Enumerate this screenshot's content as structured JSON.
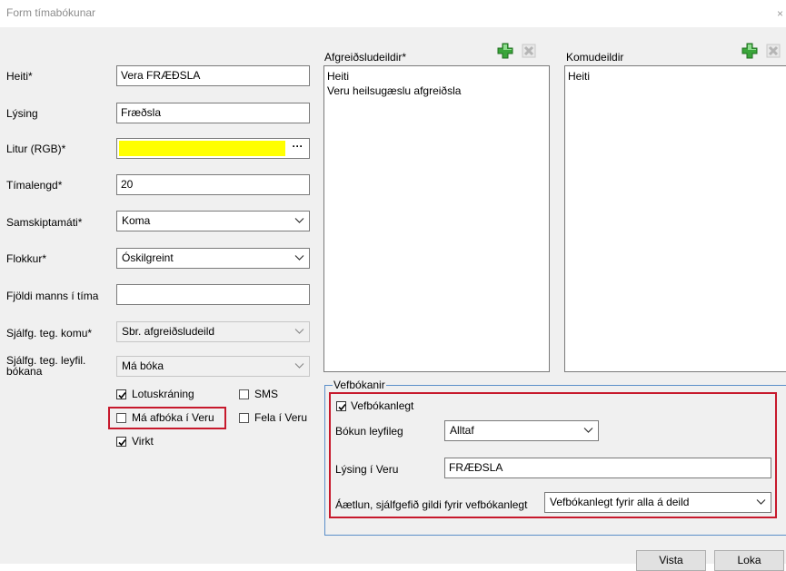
{
  "window": {
    "title": "Form tímabókunar",
    "close_glyph": "×"
  },
  "fields": {
    "heiti": {
      "label": "Heiti*",
      "value": "Vera FRÆÐSLA"
    },
    "lysing": {
      "label": "Lýsing",
      "value": "Fræðsla"
    },
    "litur": {
      "label": "Litur (RGB)*",
      "color": "#ffff00",
      "button": "···"
    },
    "timalengd": {
      "label": "Tímalengd*",
      "value": "20"
    },
    "samskiptamati": {
      "label": "Samskiptamáti*",
      "value": "Koma"
    },
    "flokkur": {
      "label": "Flokkur*",
      "value": "Óskilgreint"
    },
    "fjoldi": {
      "label": "Fjöldi manns í tíma",
      "value": ""
    },
    "sjalfg_komu": {
      "label": "Sjálfg. teg. komu*",
      "value": "Sbr. afgreiðsludeild"
    },
    "sjalfg_leyfil": {
      "label_line1": "Sjálfg. teg. leyfil.",
      "label_line2": "bókana",
      "value": "Má bóka"
    }
  },
  "checkboxes": {
    "lotuskraning": {
      "label": "Lotuskráning",
      "checked": true
    },
    "sms": {
      "label": "SMS",
      "checked": false
    },
    "ma_afboka": {
      "label": "Má afbóka í Veru",
      "checked": false
    },
    "fela": {
      "label": "Fela í Veru",
      "checked": false
    },
    "virkt": {
      "label": "Virkt",
      "checked": true
    }
  },
  "afgreidsludeildir": {
    "label": "Afgreiðsludeildir*",
    "header": "Heiti",
    "items": [
      "Veru heilsugæslu afgreiðsla"
    ]
  },
  "komudeildir": {
    "label": "Komudeildir",
    "header": "Heiti",
    "items": []
  },
  "vefbokanir": {
    "legend": "Vefbókanir",
    "vefbokanlegt": {
      "label": "Vefbókanlegt",
      "checked": true
    },
    "bokun_leyfileg": {
      "label": "Bókun leyfileg",
      "value": "Alltaf"
    },
    "lysing_veru": {
      "label": "Lýsing í Veru",
      "value": "FRÆÐSLA"
    },
    "aaetlun": {
      "label": "Áætlun, sjálfgefið gildi fyrir vefbókanlegt",
      "value": "Vefbókanlegt fyrir alla á deild"
    }
  },
  "buttons": {
    "vista": "Vista",
    "loka": "Loka"
  },
  "colors": {
    "highlight_border": "#c7192c",
    "groupbox_border": "#5b8fc9",
    "add_icon": "#3aa53a"
  }
}
